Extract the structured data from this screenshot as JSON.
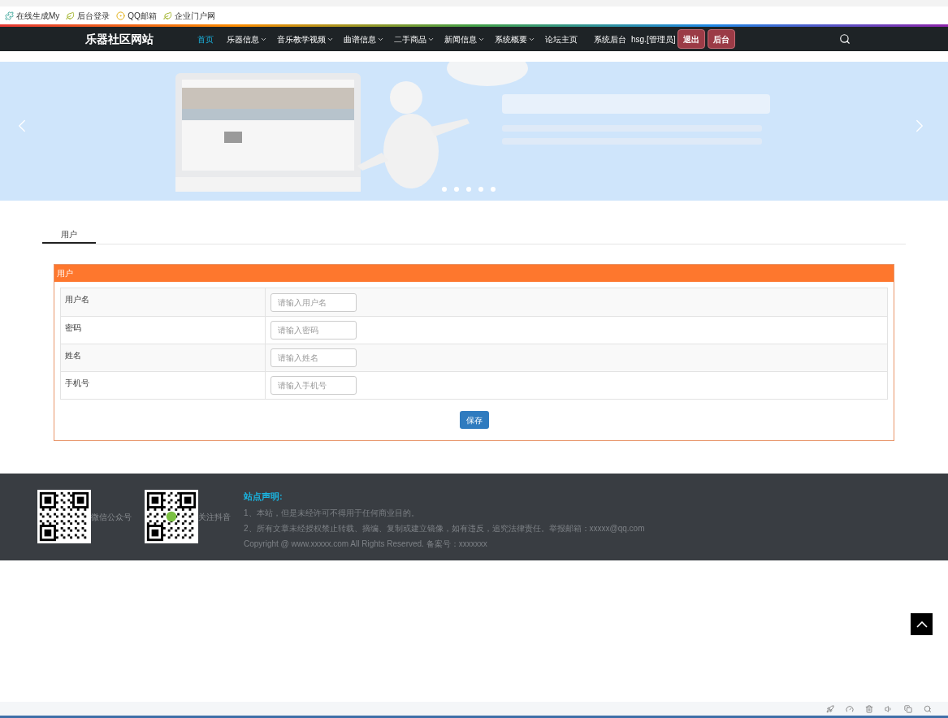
{
  "bookmarks": [
    {
      "label": "在线生成My"
    },
    {
      "label": "后台登录"
    },
    {
      "label": "QQ邮箱"
    },
    {
      "label": "企业门户网"
    }
  ],
  "nav": {
    "brand": "乐器社区网站",
    "items": [
      {
        "label": "首页",
        "selected": true,
        "dropdown": false
      },
      {
        "label": "乐器信息",
        "selected": false,
        "dropdown": true
      },
      {
        "label": "音乐教学视频",
        "selected": false,
        "dropdown": true
      },
      {
        "label": "曲谱信息",
        "selected": false,
        "dropdown": true
      },
      {
        "label": "二手商品",
        "selected": false,
        "dropdown": true
      },
      {
        "label": "新闻信息",
        "selected": false,
        "dropdown": true
      },
      {
        "label": "系统概要",
        "selected": false,
        "dropdown": true
      },
      {
        "label": "论坛主页",
        "selected": false,
        "dropdown": false
      },
      {
        "label": "系统后台",
        "selected": false,
        "dropdown": false
      }
    ],
    "user": "hsg.[管理员]",
    "buttons": [
      "退出",
      "后台"
    ]
  },
  "tabs": [
    {
      "label": "用户",
      "selected": true
    }
  ],
  "panel": {
    "title": "用户",
    "fields": [
      {
        "label": "用户名",
        "placeholder": "请输入用户名"
      },
      {
        "label": "密码",
        "placeholder": "请输入密码"
      },
      {
        "label": "姓名",
        "placeholder": "请输入姓名"
      },
      {
        "label": "手机号",
        "placeholder": "请输入手机号"
      }
    ],
    "save": "保存"
  },
  "footer": {
    "qrcodes": [
      {
        "caption": "微信公众号"
      },
      {
        "caption": "关注抖音"
      }
    ],
    "heading": "站点声明:",
    "lines": [
      "1、本站，但是未经许可不得用于任何商业目的。",
      "2、所有文章未经授权禁止转载、摘编、复制或建立镜像，如有违反，追究法律责任。举报邮箱：xxxxx@qq.com",
      "Copyright @ www.xxxxx.com All Rights Reserved. 备案号：xxxxxxx"
    ]
  }
}
